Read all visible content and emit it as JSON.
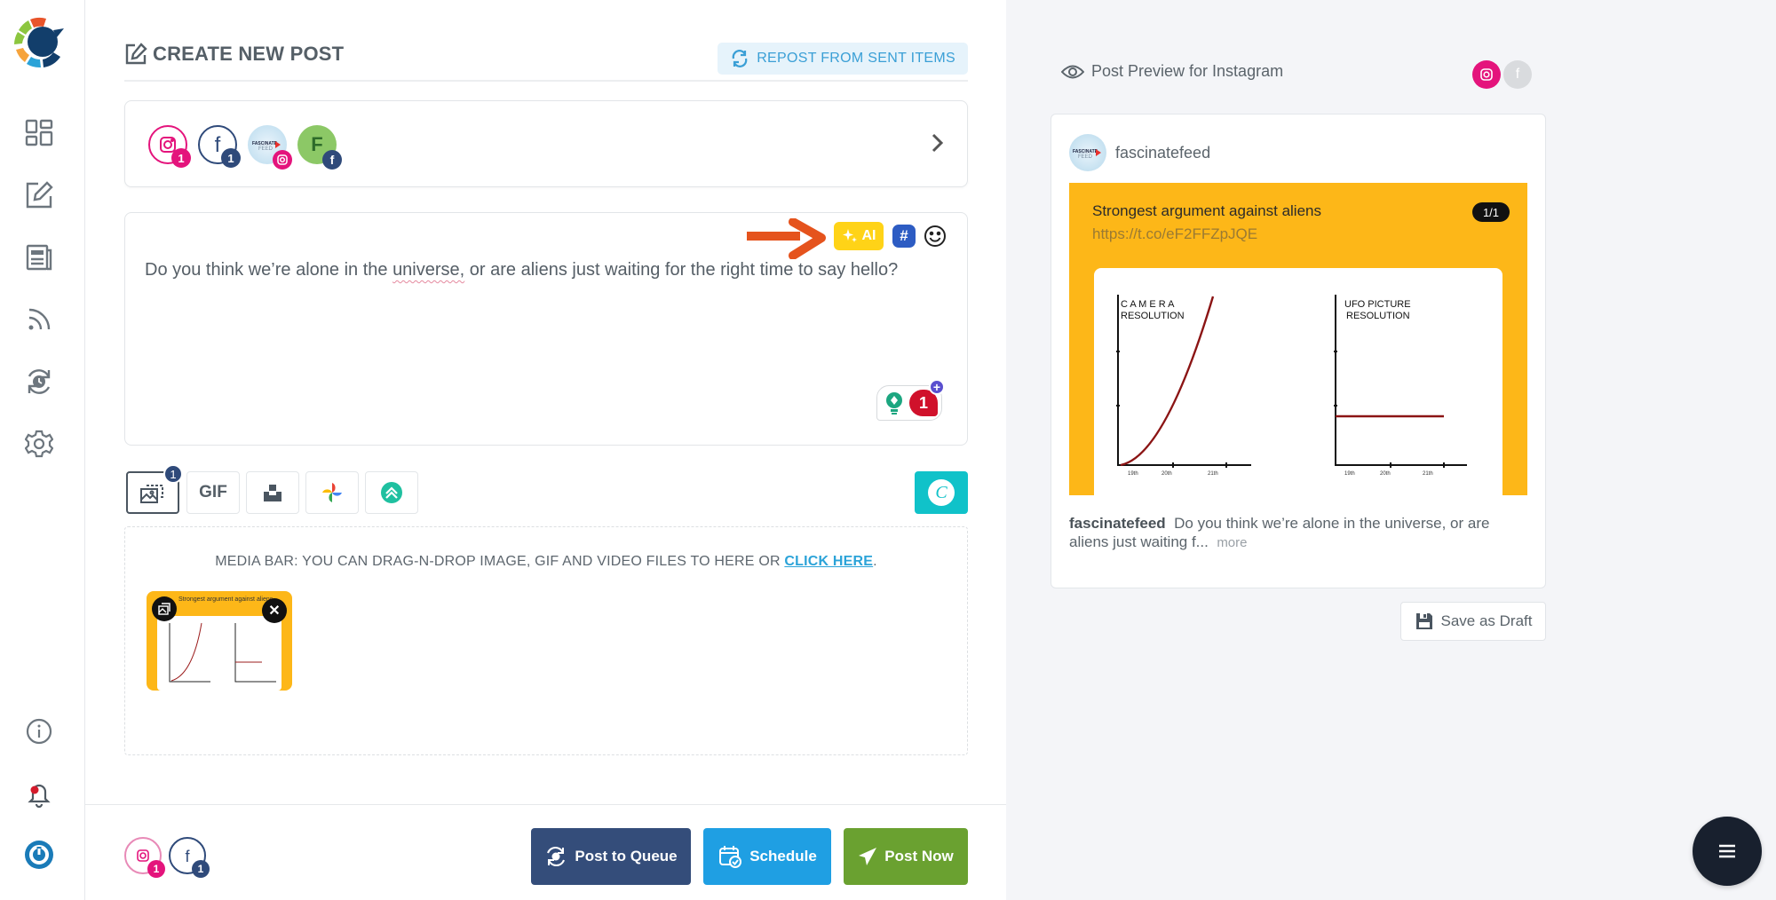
{
  "sidebar": {
    "logo": "app-logo",
    "items": [
      {
        "name": "dashboard",
        "icon": "grid-icon"
      },
      {
        "name": "compose",
        "icon": "edit-icon"
      },
      {
        "name": "posts",
        "icon": "newspaper-icon"
      },
      {
        "name": "feeds",
        "icon": "rss-icon"
      },
      {
        "name": "queue",
        "icon": "clock-sync-icon"
      },
      {
        "name": "settings",
        "icon": "gear-icon"
      }
    ],
    "bottom_items": [
      {
        "name": "info",
        "icon": "info-icon"
      },
      {
        "name": "notifications",
        "icon": "bell-icon"
      },
      {
        "name": "power",
        "icon": "power-icon"
      }
    ]
  },
  "header": {
    "title": "CREATE NEW POST",
    "repost_label": "REPOST FROM SENT ITEMS"
  },
  "accounts": [
    {
      "type": "instagram-group",
      "count": "1",
      "color": "#e4147c"
    },
    {
      "type": "facebook-group",
      "count": "1",
      "color": "#2f4a7a"
    },
    {
      "type": "instagram-profile",
      "label": "FASCINATE FEED"
    },
    {
      "type": "facebook-page",
      "initial": "F"
    }
  ],
  "editor": {
    "text_before": "Do you think we’re alone in the ",
    "text_misspelled": "universe,",
    "text_after": " or are aliens just waiting for the right time to say hello?",
    "ai_label": "AI",
    "hashtag_label": "#",
    "notification_count": "1"
  },
  "media_tools": {
    "image_count": "1",
    "gif_label": "GIF",
    "canva_label": "C"
  },
  "dropzone": {
    "text": "MEDIA BAR: YOU CAN DRAG-N-DROP IMAGE, GIF AND VIDEO FILES TO HERE OR ",
    "link": "CLICK HERE",
    "suffix": ".",
    "thumb_title": "Strongest argument against aliens"
  },
  "footer": {
    "instagram_count": "1",
    "facebook_count": "1",
    "queue_label": "Post to Queue",
    "schedule_label": "Schedule",
    "post_now_label": "Post Now",
    "colors": {
      "queue": "#344d7a",
      "schedule": "#1f9fe3",
      "post_now": "#6aa130"
    }
  },
  "preview": {
    "heading": "Post Preview for Instagram",
    "username": "fascinatefeed",
    "image_title": "Strongest argument against aliens",
    "image_url": "https://t.co/eF2FFZpJQE",
    "image_counter": "1/1",
    "chart_left": {
      "title_line1": "C A M E R A",
      "title_line2": "RESOLUTION",
      "ticks": [
        "19th",
        "20th",
        "21th"
      ]
    },
    "chart_right": {
      "title_line1": "UFO PICTURE",
      "title_line2": "RESOLUTION",
      "ticks": [
        "19th",
        "20th",
        "21th"
      ]
    },
    "caption_user": "fascinatefeed",
    "caption_text": "Do you think we’re alone in the universe, or are aliens just waiting f...",
    "more_label": "more",
    "save_draft_label": "Save as Draft"
  },
  "fab": {
    "icon": "menu-icon"
  }
}
